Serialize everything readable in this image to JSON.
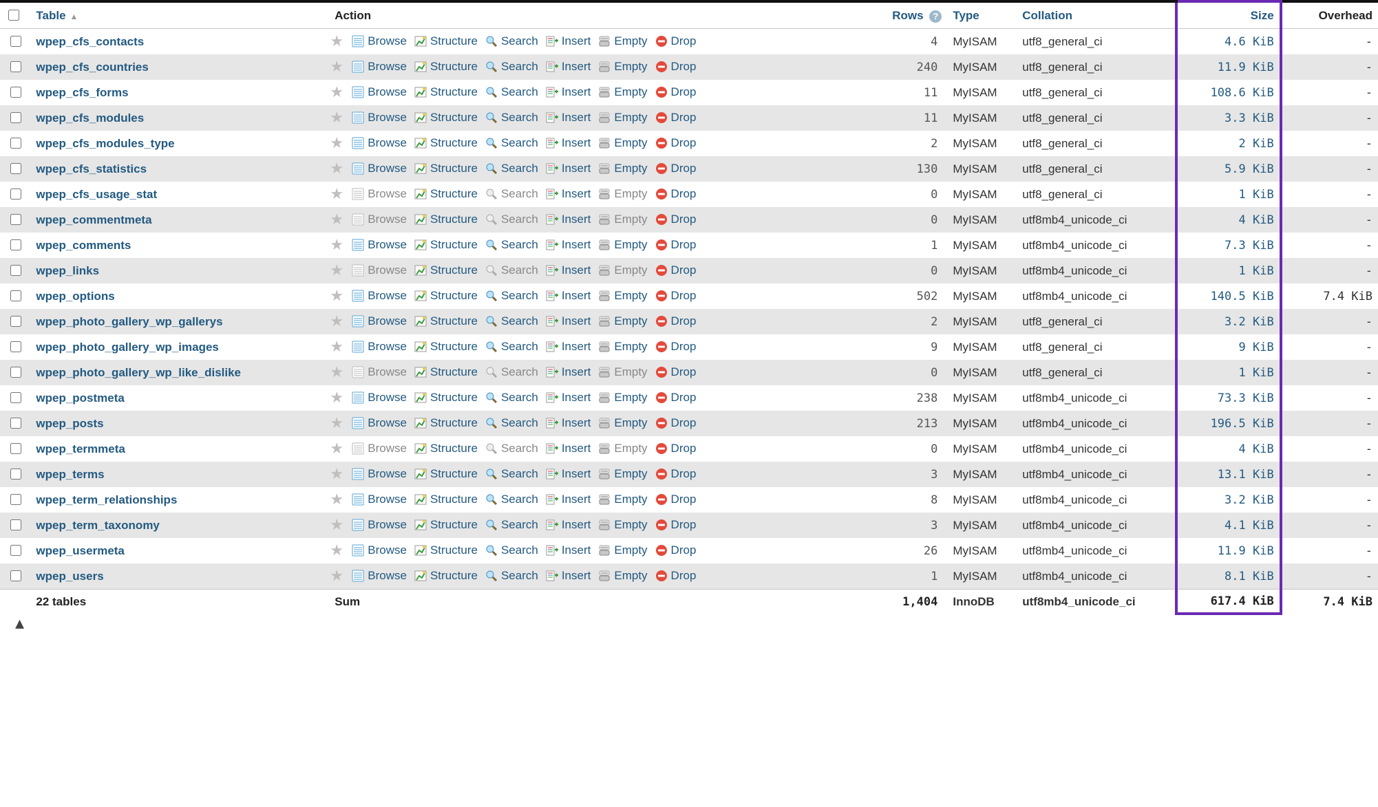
{
  "headers": {
    "table": "Table",
    "action": "Action",
    "rows": "Rows",
    "type": "Type",
    "collation": "Collation",
    "size": "Size",
    "overhead": "Overhead"
  },
  "action_labels": {
    "browse": "Browse",
    "structure": "Structure",
    "search": "Search",
    "insert": "Insert",
    "empty": "Empty",
    "drop": "Drop"
  },
  "tables": [
    {
      "name": "wpep_cfs_contacts",
      "rows": "4",
      "type": "MyISAM",
      "collation": "utf8_general_ci",
      "size": "4.6 KiB",
      "overhead": "-",
      "dim": false
    },
    {
      "name": "wpep_cfs_countries",
      "rows": "240",
      "type": "MyISAM",
      "collation": "utf8_general_ci",
      "size": "11.9 KiB",
      "overhead": "-",
      "dim": false
    },
    {
      "name": "wpep_cfs_forms",
      "rows": "11",
      "type": "MyISAM",
      "collation": "utf8_general_ci",
      "size": "108.6 KiB",
      "overhead": "-",
      "dim": false
    },
    {
      "name": "wpep_cfs_modules",
      "rows": "11",
      "type": "MyISAM",
      "collation": "utf8_general_ci",
      "size": "3.3 KiB",
      "overhead": "-",
      "dim": false
    },
    {
      "name": "wpep_cfs_modules_type",
      "rows": "2",
      "type": "MyISAM",
      "collation": "utf8_general_ci",
      "size": "2 KiB",
      "overhead": "-",
      "dim": false
    },
    {
      "name": "wpep_cfs_statistics",
      "rows": "130",
      "type": "MyISAM",
      "collation": "utf8_general_ci",
      "size": "5.9 KiB",
      "overhead": "-",
      "dim": false
    },
    {
      "name": "wpep_cfs_usage_stat",
      "rows": "0",
      "type": "MyISAM",
      "collation": "utf8_general_ci",
      "size": "1 KiB",
      "overhead": "-",
      "dim": true
    },
    {
      "name": "wpep_commentmeta",
      "rows": "0",
      "type": "MyISAM",
      "collation": "utf8mb4_unicode_ci",
      "size": "4 KiB",
      "overhead": "-",
      "dim": true
    },
    {
      "name": "wpep_comments",
      "rows": "1",
      "type": "MyISAM",
      "collation": "utf8mb4_unicode_ci",
      "size": "7.3 KiB",
      "overhead": "-",
      "dim": false
    },
    {
      "name": "wpep_links",
      "rows": "0",
      "type": "MyISAM",
      "collation": "utf8mb4_unicode_ci",
      "size": "1 KiB",
      "overhead": "-",
      "dim": true
    },
    {
      "name": "wpep_options",
      "rows": "502",
      "type": "MyISAM",
      "collation": "utf8mb4_unicode_ci",
      "size": "140.5 KiB",
      "overhead": "7.4 KiB",
      "dim": false
    },
    {
      "name": "wpep_photo_gallery_wp_gallerys",
      "rows": "2",
      "type": "MyISAM",
      "collation": "utf8_general_ci",
      "size": "3.2 KiB",
      "overhead": "-",
      "dim": false
    },
    {
      "name": "wpep_photo_gallery_wp_images",
      "rows": "9",
      "type": "MyISAM",
      "collation": "utf8_general_ci",
      "size": "9 KiB",
      "overhead": "-",
      "dim": false
    },
    {
      "name": "wpep_photo_gallery_wp_like_dislike",
      "rows": "0",
      "type": "MyISAM",
      "collation": "utf8_general_ci",
      "size": "1 KiB",
      "overhead": "-",
      "dim": true
    },
    {
      "name": "wpep_postmeta",
      "rows": "238",
      "type": "MyISAM",
      "collation": "utf8mb4_unicode_ci",
      "size": "73.3 KiB",
      "overhead": "-",
      "dim": false
    },
    {
      "name": "wpep_posts",
      "rows": "213",
      "type": "MyISAM",
      "collation": "utf8mb4_unicode_ci",
      "size": "196.5 KiB",
      "overhead": "-",
      "dim": false
    },
    {
      "name": "wpep_termmeta",
      "rows": "0",
      "type": "MyISAM",
      "collation": "utf8mb4_unicode_ci",
      "size": "4 KiB",
      "overhead": "-",
      "dim": true
    },
    {
      "name": "wpep_terms",
      "rows": "3",
      "type": "MyISAM",
      "collation": "utf8mb4_unicode_ci",
      "size": "13.1 KiB",
      "overhead": "-",
      "dim": false
    },
    {
      "name": "wpep_term_relationships",
      "rows": "8",
      "type": "MyISAM",
      "collation": "utf8mb4_unicode_ci",
      "size": "3.2 KiB",
      "overhead": "-",
      "dim": false
    },
    {
      "name": "wpep_term_taxonomy",
      "rows": "3",
      "type": "MyISAM",
      "collation": "utf8mb4_unicode_ci",
      "size": "4.1 KiB",
      "overhead": "-",
      "dim": false
    },
    {
      "name": "wpep_usermeta",
      "rows": "26",
      "type": "MyISAM",
      "collation": "utf8mb4_unicode_ci",
      "size": "11.9 KiB",
      "overhead": "-",
      "dim": false
    },
    {
      "name": "wpep_users",
      "rows": "1",
      "type": "MyISAM",
      "collation": "utf8mb4_unicode_ci",
      "size": "8.1 KiB",
      "overhead": "-",
      "dim": false
    }
  ],
  "summary": {
    "count_label": "22 tables",
    "sum_label": "Sum",
    "rows": "1,404",
    "type": "InnoDB",
    "collation": "utf8mb4_unicode_ci",
    "size": "617.4 KiB",
    "overhead": "7.4 KiB"
  }
}
